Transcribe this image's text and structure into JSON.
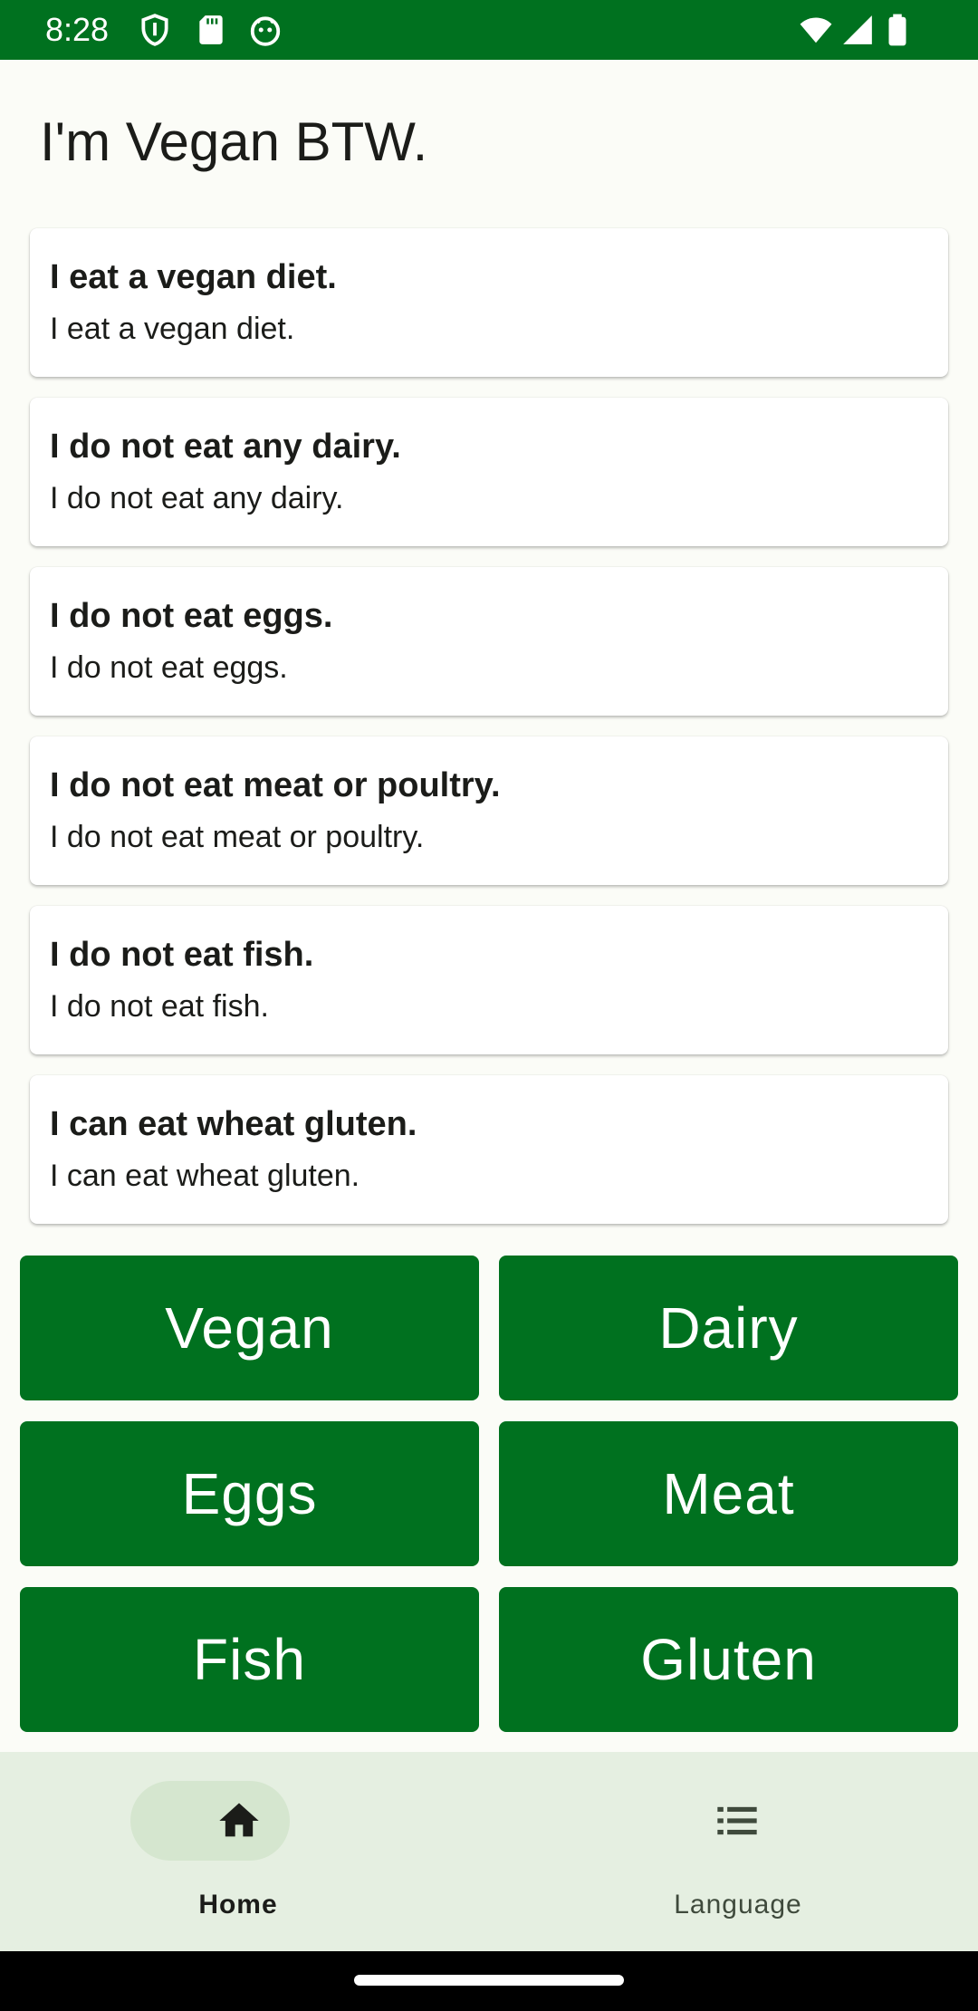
{
  "status_bar": {
    "time": "8:28",
    "background": "#00711f",
    "left_icons": [
      "shield-icon",
      "sd-card-icon",
      "android-debug-icon"
    ],
    "right_icons": [
      "wifi-icon",
      "signal-icon",
      "battery-icon"
    ]
  },
  "app": {
    "title": "I'm Vegan BTW."
  },
  "cards": [
    {
      "title": "I eat a vegan diet.",
      "subtitle": "I eat a vegan diet."
    },
    {
      "title": "I do not eat any dairy.",
      "subtitle": "I do not eat any dairy."
    },
    {
      "title": "I do not eat eggs.",
      "subtitle": "I do not eat eggs."
    },
    {
      "title": "I do not eat meat or poultry.",
      "subtitle": "I do not eat meat or poultry."
    },
    {
      "title": "I do not eat fish.",
      "subtitle": "I do not eat fish."
    },
    {
      "title": "I can eat wheat gluten.",
      "subtitle": "I can eat wheat gluten."
    }
  ],
  "buttons": [
    {
      "label": "Vegan"
    },
    {
      "label": "Dairy"
    },
    {
      "label": "Eggs"
    },
    {
      "label": "Meat"
    },
    {
      "label": "Fish"
    },
    {
      "label": "Gluten"
    }
  ],
  "colors": {
    "accent": "#00711f",
    "nav_background": "#e5efe1",
    "nav_active_pill": "#d5e6cf"
  },
  "bottom_nav": {
    "items": [
      {
        "label": "Home",
        "icon": "home-icon",
        "active": true
      },
      {
        "label": "Language",
        "icon": "list-icon",
        "active": false
      }
    ]
  }
}
